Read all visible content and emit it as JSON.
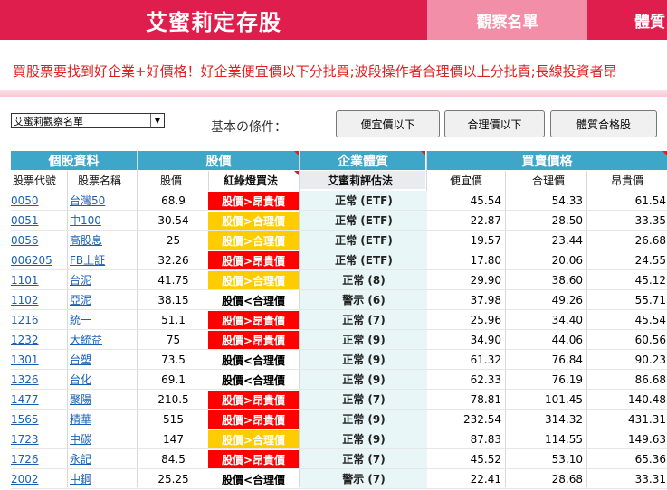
{
  "header": {
    "brand": "艾蜜莉定存股",
    "tab_watchlist": "觀察名單",
    "tab_health": "體質"
  },
  "marquee": "買股票要找到好企業+好價格！好企業便宜價以下分批買;波段操作者合理價以上分批賣;長線投資者昂",
  "toolbar": {
    "list_select": "艾蜜莉觀察名單",
    "conditions_label": "基本の條件：",
    "btn_cheap": "便宜價以下",
    "btn_fair": "合理價以下",
    "btn_health": "體質合格股"
  },
  "table": {
    "groups": [
      "個股資料",
      "股價",
      "企業體質",
      "買賣價格"
    ],
    "columns": [
      "股票代號",
      "股票名稱",
      "股價",
      "紅綠燈買法",
      "艾蜜莉評估法",
      "便宜價",
      "合理價",
      "昂貴價"
    ],
    "rows": [
      {
        "code": "0050",
        "name": "台灣50",
        "price": "68.9",
        "signal": "股價>昂貴價",
        "sig": "red",
        "eval": "正常 (ETF)",
        "cheap": "45.54",
        "fair": "54.33",
        "exp": "61.54"
      },
      {
        "code": "0051",
        "name": "中100",
        "price": "30.54",
        "signal": "股價>合理價",
        "sig": "yellow",
        "eval": "正常 (ETF)",
        "cheap": "22.87",
        "fair": "28.50",
        "exp": "33.35"
      },
      {
        "code": "0056",
        "name": "高股息",
        "price": "25",
        "signal": "股價>合理價",
        "sig": "yellow",
        "eval": "正常 (ETF)",
        "cheap": "19.57",
        "fair": "23.44",
        "exp": "26.68"
      },
      {
        "code": "006205",
        "name": "FB上証",
        "price": "32.26",
        "signal": "股價>昂貴價",
        "sig": "red",
        "eval": "正常 (ETF)",
        "cheap": "17.80",
        "fair": "20.06",
        "exp": "24.55"
      },
      {
        "code": "1101",
        "name": "台泥",
        "price": "41.75",
        "signal": "股價>合理價",
        "sig": "yellow",
        "eval": "正常 (8)",
        "cheap": "29.90",
        "fair": "38.60",
        "exp": "45.12"
      },
      {
        "code": "1102",
        "name": "亞泥",
        "price": "38.15",
        "signal": "股價<合理價",
        "sig": "plain",
        "eval": "警示 (6)",
        "cheap": "37.98",
        "fair": "49.26",
        "exp": "55.71"
      },
      {
        "code": "1216",
        "name": "統一",
        "price": "51.1",
        "signal": "股價>昂貴價",
        "sig": "red",
        "eval": "正常 (7)",
        "cheap": "25.96",
        "fair": "34.40",
        "exp": "45.54"
      },
      {
        "code": "1232",
        "name": "大統益",
        "price": "75",
        "signal": "股價>昂貴價",
        "sig": "red",
        "eval": "正常 (9)",
        "cheap": "34.90",
        "fair": "44.06",
        "exp": "60.56"
      },
      {
        "code": "1301",
        "name": "台塑",
        "price": "73.5",
        "signal": "股價<合理價",
        "sig": "plain",
        "eval": "正常 (9)",
        "cheap": "61.32",
        "fair": "76.84",
        "exp": "90.23"
      },
      {
        "code": "1326",
        "name": "台化",
        "price": "69.1",
        "signal": "股價<合理價",
        "sig": "plain",
        "eval": "正常 (9)",
        "cheap": "62.33",
        "fair": "76.19",
        "exp": "86.68"
      },
      {
        "code": "1477",
        "name": "聚陽",
        "price": "210.5",
        "signal": "股價>昂貴價",
        "sig": "red",
        "eval": "正常 (7)",
        "cheap": "78.81",
        "fair": "101.45",
        "exp": "140.48"
      },
      {
        "code": "1565",
        "name": "精華",
        "price": "515",
        "signal": "股價>昂貴價",
        "sig": "red",
        "eval": "正常 (9)",
        "cheap": "232.54",
        "fair": "314.32",
        "exp": "431.31"
      },
      {
        "code": "1723",
        "name": "中碳",
        "price": "147",
        "signal": "股價>合理價",
        "sig": "yellow",
        "eval": "正常 (9)",
        "cheap": "87.83",
        "fair": "114.55",
        "exp": "149.63"
      },
      {
        "code": "1726",
        "name": "永記",
        "price": "84.5",
        "signal": "股價>昂貴價",
        "sig": "red",
        "eval": "正常 (7)",
        "cheap": "45.52",
        "fair": "53.10",
        "exp": "65.36"
      },
      {
        "code": "2002",
        "name": "中鋼",
        "price": "25.25",
        "signal": "股價<合理價",
        "sig": "plain",
        "eval": "警示 (7)",
        "cheap": "22.41",
        "fair": "28.68",
        "exp": "33.31"
      }
    ]
  },
  "colors": {
    "brand_red": "#e01e4e",
    "tab_pink": "#f38ea8",
    "header_blue": "#3ea6c8",
    "signal_red": "#ff0000",
    "signal_yellow": "#ffcc00"
  }
}
